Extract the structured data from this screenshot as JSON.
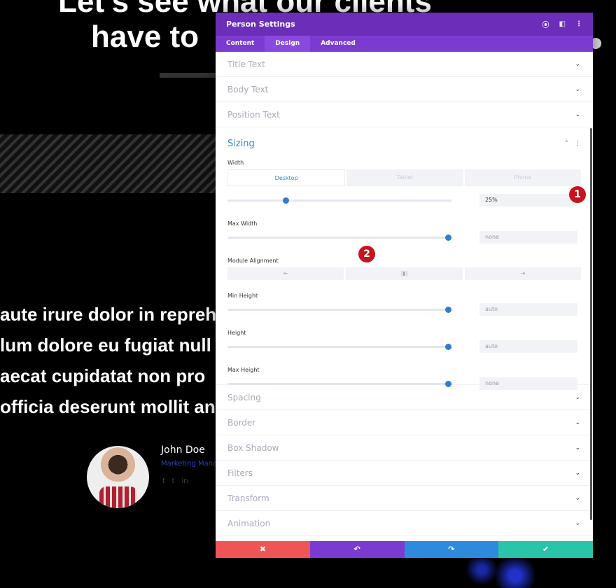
{
  "background": {
    "heading_line1": "Let's see what our clients",
    "heading_line2": "have to",
    "paragraph": [
      "aute irure dolor in repreh",
      "lum dolore eu fugiat null",
      "aecat cupidatat non pro",
      "officia deserunt mollit an"
    ],
    "person": {
      "name": "John Doe",
      "role": "Marketing Manager",
      "social": [
        "f",
        "t",
        "in"
      ]
    }
  },
  "panel": {
    "title": "Person Settings",
    "header_icons": [
      "focus-icon",
      "split-view-icon",
      "more-icon"
    ],
    "tabs": [
      {
        "label": "Content"
      },
      {
        "label": "Design",
        "active": true
      },
      {
        "label": "Advanced"
      }
    ],
    "sections_top": [
      "Title Text",
      "Body Text",
      "Position Text"
    ],
    "sizing": {
      "title": "Sizing",
      "width_label": "Width",
      "devices": [
        "Desktop",
        "Tablet",
        "Phone"
      ],
      "width_value": "25%",
      "width_slider": 25,
      "max_width_label": "Max Width",
      "max_width_value": "none",
      "alignment_label": "Module Alignment",
      "alignment_options": [
        "⇤",
        "|▮|",
        "⇥"
      ],
      "min_height_label": "Min Height",
      "min_height_value": "auto",
      "height_label": "Height",
      "height_value": "auto",
      "max_height_label": "Max Height",
      "max_height_value": "none"
    },
    "sections_bottom": [
      "Spacing",
      "Border",
      "Box Shadow",
      "Filters",
      "Transform",
      "Animation"
    ],
    "footer": {
      "cancel": "✖",
      "undo": "↶",
      "redo": "↷",
      "save": "✔"
    },
    "colors": {
      "header": "#6c2eb9",
      "tabs": "#7b3bd1",
      "cancel": "#ef5555",
      "undo": "#7b3bd1",
      "redo": "#2e8bdc",
      "save": "#29c4a9"
    }
  },
  "badges": [
    "1",
    "2"
  ]
}
